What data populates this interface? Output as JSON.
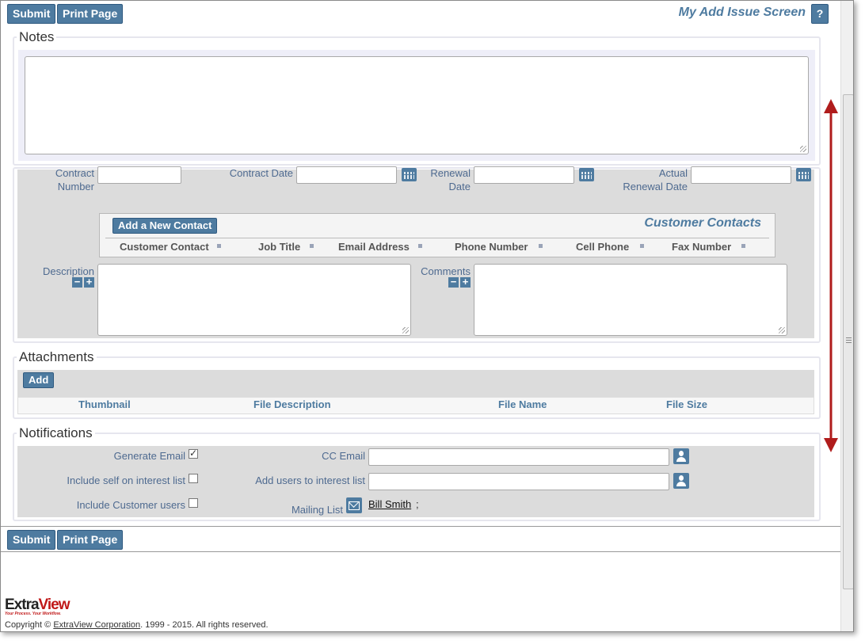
{
  "toolbar": {
    "submit_label": "Submit",
    "print_label": "Print Page",
    "screen_title": "My Add Issue Screen",
    "help_label": "?"
  },
  "notes": {
    "legend": "Notes"
  },
  "contract": {
    "contract_number_label": "Contract Number",
    "contract_date_label": "Contract Date",
    "renewal_date_label": "Renewal Date",
    "actual_renewal_date_label": "Actual Renewal Date"
  },
  "contacts": {
    "add_button": "Add a New Contact",
    "title": "Customer Contacts",
    "columns": [
      "Customer Contact",
      "Job Title",
      "Email Address",
      "Phone Number",
      "Cell Phone",
      "Fax Number"
    ]
  },
  "description_label": "Description",
  "comments_label": "Comments",
  "attachments": {
    "legend": "Attachments",
    "add_button": "Add",
    "columns": [
      "Thumbnail",
      "File Description",
      "File Name",
      "File Size"
    ]
  },
  "notifications": {
    "legend": "Notifications",
    "generate_email_label": "Generate Email",
    "generate_email_checked": true,
    "include_self_label": "Include self on interest list",
    "include_customer_label": "Include Customer users",
    "cc_email_label": "CC Email",
    "add_users_label": "Add users to interest list",
    "mailing_list_label": "Mailing List",
    "mailing_list_value": "Bill Smith",
    "mailing_list_sep": ";"
  },
  "footer": {
    "logo_text_a": "Extra",
    "logo_text_b": "View",
    "logo_tag": "Your Process. Your Workflow.",
    "copyright_prefix": "Copyright ©",
    "company_link": "ExtraView Corporation",
    "copyright_suffix": ". 1999 - 2015.  All rights reserved."
  },
  "colors": {
    "accent": "#4e7ba0",
    "arrow": "#b01c1c"
  }
}
